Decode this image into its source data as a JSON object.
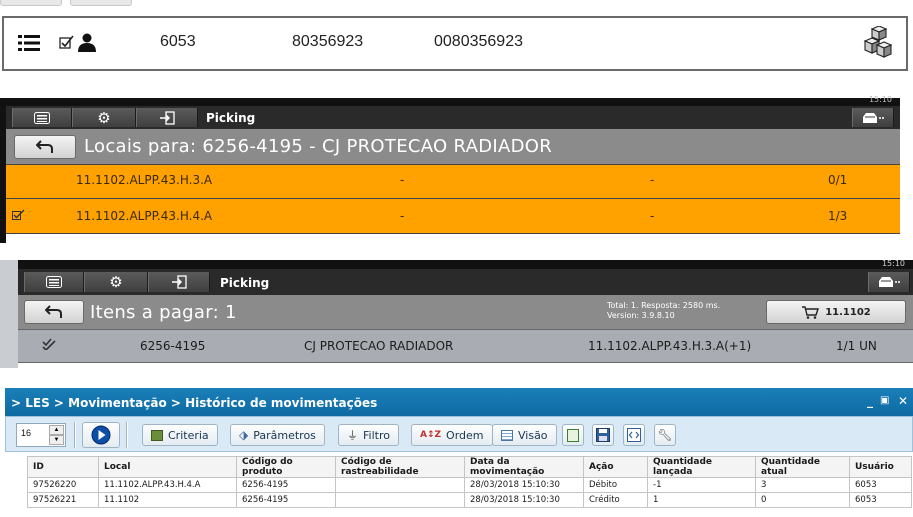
{
  "panel1": {
    "user_code": "6053",
    "number_a": "80356923",
    "number_b": "0080356923",
    "icons": [
      "list-icon",
      "checkbox-icon",
      "user-icon",
      "boxes-icon"
    ]
  },
  "panel2": {
    "clock": "15:10",
    "app_label": "Picking",
    "title": "Locais para: 6256-4195 - CJ PROTECAO RADIADOR",
    "rows": [
      {
        "location": "11.1102.ALPP.43.H.3.A",
        "col2": "-",
        "col3": "-",
        "qty": "0/1",
        "checked": false
      },
      {
        "location": "11.1102.ALPP.43.H.4.A",
        "col2": "-",
        "col3": "-",
        "qty": "1/3",
        "checked": true
      }
    ]
  },
  "panel3": {
    "clock": "15:10",
    "app_label": "Picking",
    "title": "Itens a pagar: 1",
    "total_line": "Total: 1. Resposta: 2580 ms.",
    "version_line": "Version: 3.9.8.10",
    "cart_label": "11.1102",
    "item": {
      "code": "6256-4195",
      "description": "CJ PROTECAO RADIADOR",
      "location": "11.1102.ALPP.43.H.3.A(+1)",
      "qty": "1/1 UN"
    }
  },
  "panel4": {
    "breadcrumb": "> LES > Movimentação > Histórico de movimentações",
    "page_size": "16",
    "buttons": {
      "criteria": "Criteria",
      "params": "Parâmetros",
      "filter": "Filtro",
      "order": "Ordem",
      "view": "Visão"
    },
    "columns": [
      "ID",
      "Local",
      "Código do produto",
      "Código de rastreabilidade",
      "Data da movimentação",
      "Ação",
      "Quantidade lançada",
      "Quantidade atual",
      "Usuário"
    ],
    "rows": [
      [
        "97526220",
        "11.1102.ALPP.43.H.4.A",
        "6256-4195",
        "",
        "28/03/2018 15:10:30",
        "Débito",
        "-1",
        "3",
        "6053"
      ],
      [
        "97526221",
        "11.1102",
        "6256-4195",
        "",
        "28/03/2018 15:10:30",
        "Crédito",
        "1",
        "0",
        "6053"
      ]
    ]
  },
  "colors": {
    "orange_row": "#ffa200",
    "les_header": "#1a7fb8",
    "toolbar_bg": "#d9eaf6"
  }
}
